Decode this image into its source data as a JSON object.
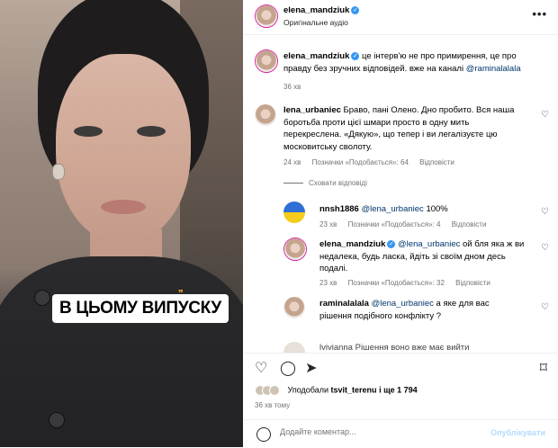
{
  "header": {
    "username": "elena_mandziuk",
    "audio": "Оригінальне аудіо",
    "more_icon": "ellipsis-icon"
  },
  "caption": {
    "username": "elena_mandziuk",
    "text": "це інтерв'ю не про примирення, це про правду без зручних відповідей. вже на каналі",
    "mention": "@raminalalala",
    "time": "36 хв"
  },
  "comments": [
    {
      "username": "lena_urbaniec",
      "text_line1": "Браво, пані Олено. Дно пробито. Вся наша",
      "text_line2": "боротьба проти цієї шм⁠ари просто в одну мить",
      "text_line3": "перекреслена. «Дякую», що тепер і ви легалізуєте цю",
      "text_line4": "московитську своло⁠ту.",
      "time": "24 хв",
      "likes": "Позначки «Подобається»: 64",
      "reply": "Відповісти"
    }
  ],
  "hide_replies": "Сховати відповіді",
  "replies": [
    {
      "username": "nnsh1886",
      "mention": "@lena_urbaniec",
      "text": "100%",
      "time": "23 хв",
      "likes": "Позначки «Подобається»: 4",
      "reply": "Відповісти"
    },
    {
      "username": "elena_mandziuk",
      "mention": "@lena_urbaniec",
      "text_line1": "ой бл⁠я яка ж ви",
      "text_line2": "недалека, будь ласка, йдіть зі своїм дном десь",
      "text_line3": "подалі.",
      "time": "23 хв",
      "likes": "Позначки «Подобається»: 32",
      "reply": "Відповісти"
    },
    {
      "username": "raminalalala",
      "mention": "@lena_urbaniec",
      "text_line1": "а яке для вас",
      "text_line2": "рішення подібного конфлікту ?",
      "partial": "lvivianna Рішення воно вже має вийти"
    }
  ],
  "video": {
    "caption_text": "В ЦЬОМУ ВИПУСКУ"
  },
  "actions": {
    "like_icon": "heart-icon",
    "comment_icon": "comment-icon",
    "share_icon": "share-icon",
    "save_icon": "bookmark-icon"
  },
  "likes_line": {
    "prefix": "Уподобали",
    "user": "tsvit_terenu",
    "suffix": "і ще 1 794"
  },
  "post_age": "36 хв тому",
  "composer": {
    "placeholder": "Додайте коментар...",
    "publish": "Опублікувати"
  }
}
